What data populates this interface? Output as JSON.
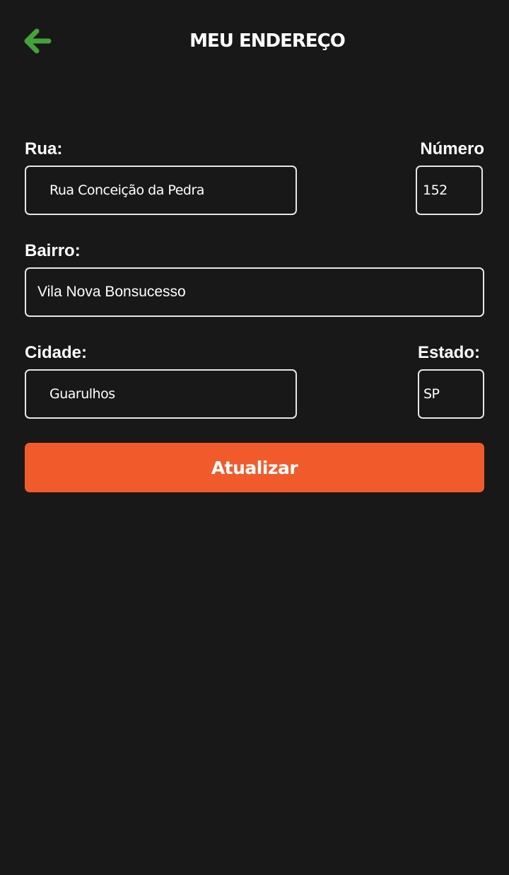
{
  "header": {
    "back_icon": "arrow-left-icon",
    "back_icon_color": "#43a33a",
    "title": "MEU ENDEREÇO"
  },
  "form": {
    "street": {
      "label": "Rua:",
      "value": "Rua Conceição da Pedra"
    },
    "number": {
      "label": "Número",
      "value": "152"
    },
    "neighborhood": {
      "label": "Bairro:",
      "value": "Vila Nova Bonsucesso"
    },
    "city": {
      "label": "Cidade:",
      "value": "Guarulhos"
    },
    "state": {
      "label": "Estado:",
      "value": "SP"
    }
  },
  "actions": {
    "update_label": "Atualizar",
    "update_color": "#f15b2b"
  },
  "theme": {
    "background": "#181818",
    "text": "#ffffff",
    "field_border": "#e6e6e6"
  }
}
